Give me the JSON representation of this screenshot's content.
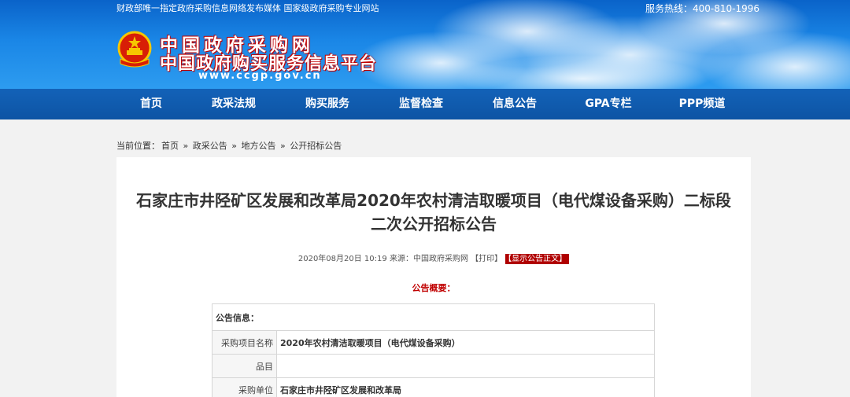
{
  "topbar": {
    "left_text": "财政部唯一指定政府采购信息网络发布媒体 国家级政府采购专业网站",
    "hotline": "服务热线：400-810-1996"
  },
  "logo": {
    "line1": "中国政府采购网",
    "line2": "中国政府购买服务信息平台",
    "url": "www.ccgp.gov.cn"
  },
  "nav": {
    "items": [
      "首页",
      "政采法规",
      "购买服务",
      "监督检查",
      "信息公告",
      "GPA专栏",
      "PPP频道"
    ]
  },
  "breadcrumb": {
    "prefix": "当前位置：",
    "items": [
      "首页",
      "政采公告",
      "地方公告",
      "公开招标公告"
    ],
    "separator": "»"
  },
  "article": {
    "title": "石家庄市井陉矿区发展和改革局2020年农村清洁取暖项目（电代煤设备采购）二标段二次公开招标公告",
    "date": "2020年08月20日 10:19",
    "source": "来源：中国政府采购网",
    "print_label": "【打印】",
    "show_label": "【显示公告正文】",
    "summary_heading": "公告概要："
  },
  "info_table": {
    "header": "公告信息：",
    "rows": [
      {
        "label": "采购项目名称",
        "value": "2020年农村清洁取暖项目（电代煤设备采购）"
      },
      {
        "label": "品目",
        "value": ""
      },
      {
        "label": "采购单位",
        "value": "石家庄市井陉矿区发展和改革局"
      }
    ]
  },
  "colors": {
    "header_blue": "#1a86e6",
    "nav_blue": "#0d54a4",
    "accent_red": "#c00000"
  }
}
